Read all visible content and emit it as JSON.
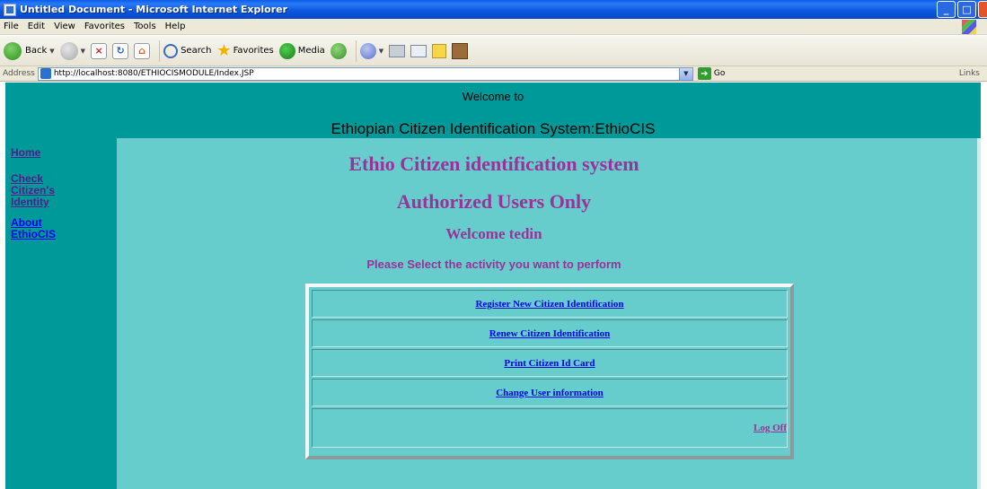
{
  "window": {
    "title": "Untitled Document - Microsoft Internet Explorer",
    "controls": [
      "minimize",
      "maximize",
      "close"
    ]
  },
  "menubar": {
    "items": [
      "File",
      "Edit",
      "View",
      "Favorites",
      "Tools",
      "Help"
    ]
  },
  "toolbar": {
    "back_label": "Back",
    "search_label": "Search",
    "favorites_label": "Favorites",
    "media_label": "Media"
  },
  "addressbar": {
    "label": "Address",
    "url": "http://localhost:8080/ETHIOCISMODULE/Index.JSP",
    "go_label": "Go",
    "links_label": "Links"
  },
  "header": {
    "welcome": "Welcome to",
    "system_title": "Ethiopian Citizen Identification System:EthioCIS"
  },
  "sidenav": {
    "home": "Home",
    "check_identity_line1": "Check",
    "check_identity_line2": "Citizen's",
    "check_identity_line3": "Identity",
    "about_line1": "About",
    "about_line2": "EthioCIS"
  },
  "main": {
    "heading1": "Ethio Citizen identification system",
    "heading2": "Authorized Users Only",
    "welcome_user": "Welcome tedin",
    "instruction": "Please Select the activity you want to perform",
    "actions": {
      "register": "Register New Citizen Identification",
      "renew": "Renew Citizen Identification",
      "print": "Print Citizen Id Card",
      "change_user": "Change User information",
      "log_off": "Log Off"
    }
  },
  "colors": {
    "page_bg": "#009999",
    "content_bg": "#66cccc",
    "heading_color": "#993399",
    "link_color": "#0000ee"
  }
}
